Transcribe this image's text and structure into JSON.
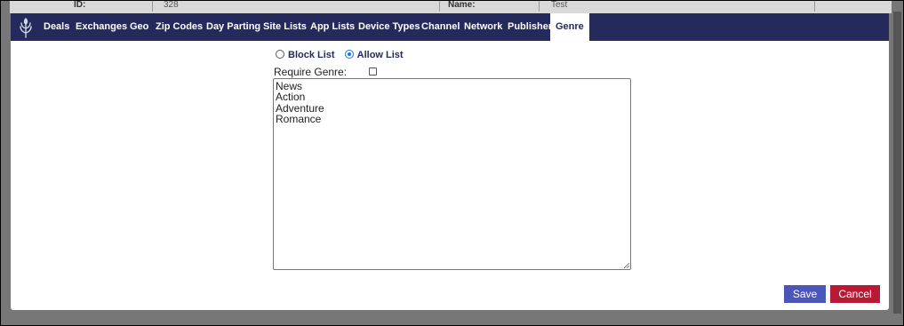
{
  "background_form": {
    "id_label": "ID:",
    "id_value": "328",
    "name_label": "Name:",
    "name_value": "Test"
  },
  "nav": {
    "items": [
      {
        "label": "Deals"
      },
      {
        "label": "Exchanges"
      },
      {
        "label": "Geo"
      },
      {
        "label": "Zip Codes"
      },
      {
        "label": "Day Parting"
      },
      {
        "label": "Site Lists"
      },
      {
        "label": "App Lists"
      },
      {
        "label": "Device Types"
      },
      {
        "label": "Channel"
      },
      {
        "label": "Network"
      },
      {
        "label": "Publisher"
      },
      {
        "label": "Genre"
      }
    ],
    "active": "Genre",
    "logo_icon": "leaf-logo-icon",
    "bar_color": "#252a5c"
  },
  "list_mode": {
    "block_label": "Block List",
    "allow_label": "Allow List",
    "selected": "Allow List"
  },
  "require_genre": {
    "label": "Require Genre:",
    "checked": false
  },
  "genres": [
    "News",
    "Action",
    "Adventure",
    "Romance"
  ],
  "buttons": {
    "save": "Save",
    "cancel": "Cancel",
    "save_color": "#4c55b8",
    "cancel_color": "#b71a36"
  }
}
